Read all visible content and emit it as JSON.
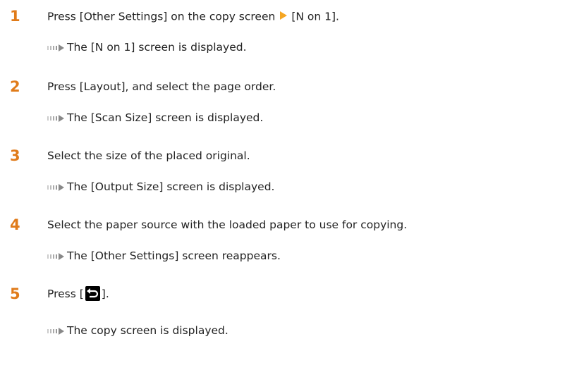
{
  "steps": [
    {
      "number": "1",
      "text_before": "Press [Other Settings] on the copy screen",
      "inline_icon": "play-arrow-icon",
      "text_after": "[N on 1].",
      "result": "The [N on 1] screen is displayed."
    },
    {
      "number": "2",
      "text": "Press [Layout], and select the page order.",
      "result": "The [Scan Size] screen is displayed."
    },
    {
      "number": "3",
      "text": "Select the size of the placed original.",
      "result": "The [Output Size] screen is displayed."
    },
    {
      "number": "4",
      "text": "Select the paper source with the loaded paper to use for copying.",
      "result": "The [Other Settings] screen reappears."
    },
    {
      "number": "5",
      "text_before": "Press [",
      "inline_icon": "back-icon",
      "text_after": "].",
      "result": "The copy screen is displayed."
    }
  ],
  "colors": {
    "step_number": "#e07b1a",
    "inline_arrow": "#f5a623",
    "result_arrow": "#aaaaaa",
    "text": "#222222"
  }
}
